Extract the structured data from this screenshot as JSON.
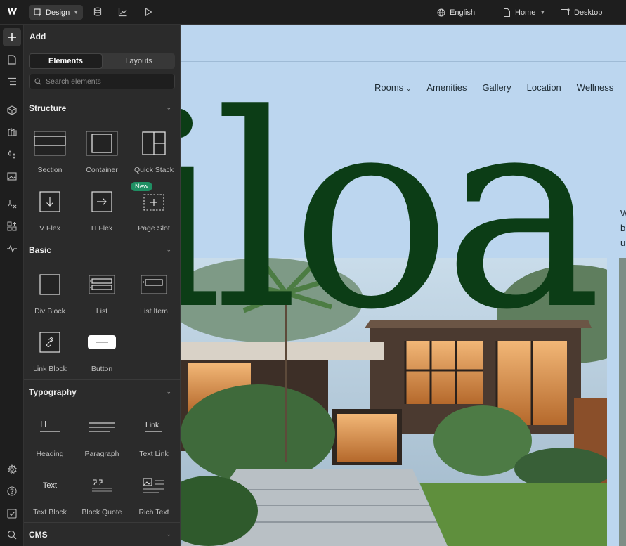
{
  "topbar": {
    "design_label": "Design",
    "language": "English",
    "page": "Home",
    "breakpoint": "Desktop",
    "icons": [
      "webflow-logo",
      "database-icon",
      "chart-icon",
      "play-icon",
      "globe-icon",
      "page-icon",
      "desktop-icon"
    ]
  },
  "rail": {
    "icons": [
      "add-icon",
      "pages-icon",
      "navigator-icon",
      "components-icon",
      "styles-icon",
      "variables-icon",
      "assets-icon",
      "logic-icon",
      "apps-icon",
      "insights-icon",
      "settings-icon",
      "help-icon",
      "checklist-icon",
      "search-icon"
    ]
  },
  "panel": {
    "title": "Add",
    "tabs": [
      "Elements",
      "Layouts"
    ],
    "search_placeholder": "Search elements",
    "sections": {
      "structure": {
        "title": "Structure",
        "items": [
          "Section",
          "Container",
          "Quick Stack",
          "V Flex",
          "H Flex",
          "Page Slot"
        ],
        "new_badge": "New"
      },
      "basic": {
        "title": "Basic",
        "items": [
          "Div Block",
          "List",
          "List Item",
          "Link Block",
          "Button"
        ]
      },
      "typography": {
        "title": "Typography",
        "items": [
          "Heading",
          "Paragraph",
          "Text Link",
          "Text Block",
          "Block Quote",
          "Rich Text"
        ],
        "glyphs": {
          "heading": "H",
          "link": "Link",
          "text": "Text"
        }
      },
      "cms": {
        "title": "CMS"
      }
    }
  },
  "canvas": {
    "nav": [
      "Rooms",
      "Amenities",
      "Gallery",
      "Location",
      "Wellness"
    ],
    "hero_word": "iloa",
    "side_letters": [
      "W",
      "b",
      "u"
    ],
    "colors": {
      "sky": "#bcd6ef",
      "brand_green": "#0c3d16"
    }
  }
}
